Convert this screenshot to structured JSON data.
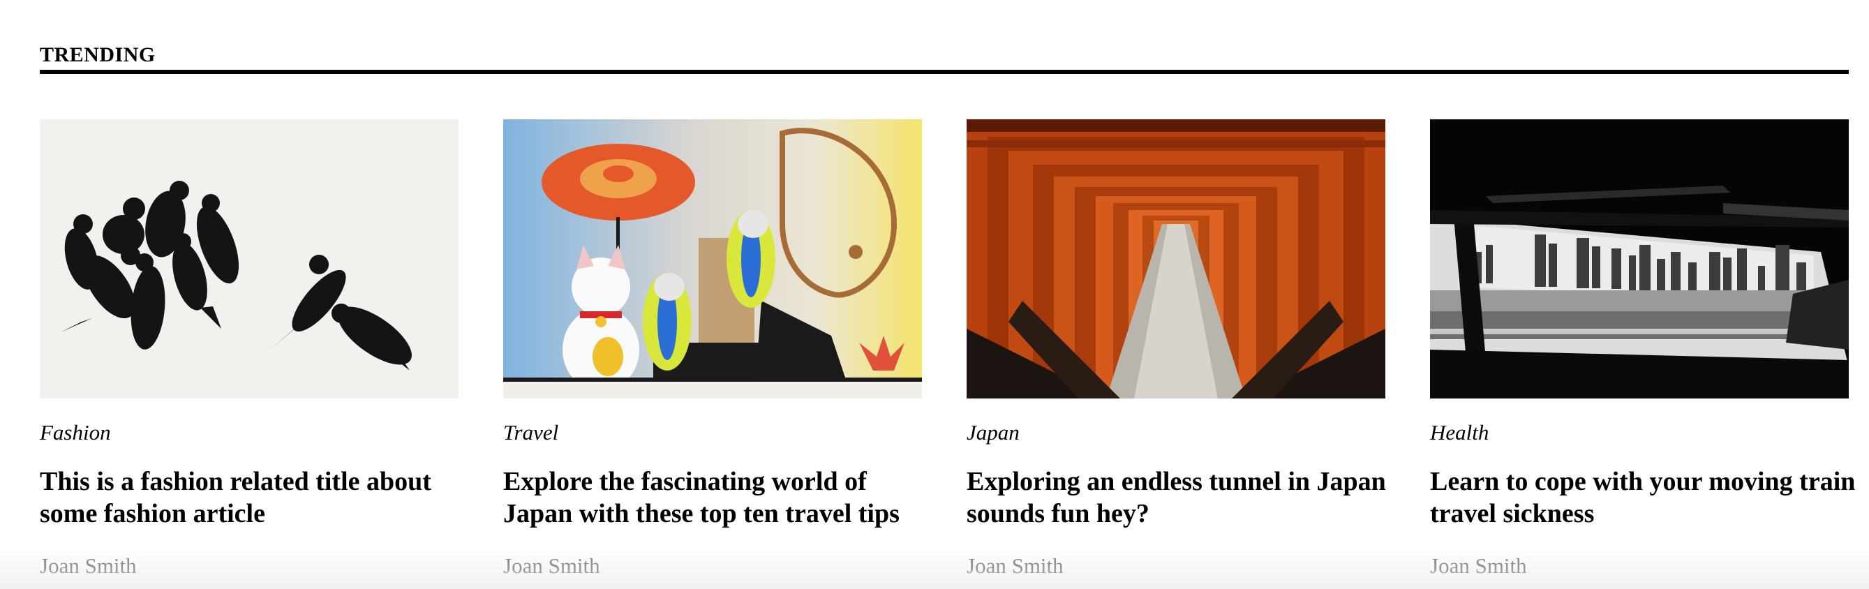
{
  "section": {
    "title": "TRENDING"
  },
  "articles": [
    {
      "category": "Fashion",
      "title": "This is a fashion related title about some fashion article",
      "author": "Joan Smith",
      "image": "crows-painting-image"
    },
    {
      "category": "Travel",
      "title": "Explore the fascinating world of Japan with these top ten travel tips",
      "author": "Joan Smith",
      "image": "sneakers-on-rug-image"
    },
    {
      "category": "Japan",
      "title": "Exploring an endless tunnel in Japan sounds fun hey?",
      "author": "Joan Smith",
      "image": "torii-gate-tunnel-image"
    },
    {
      "category": "Health",
      "title": "Learn to cope with your moving train travel sickness",
      "author": "Joan Smith",
      "image": "train-window-skyline-image"
    }
  ],
  "colors": {
    "text": "#000000",
    "author": "#777777",
    "rule": "#000000",
    "background": "#ffffff"
  }
}
